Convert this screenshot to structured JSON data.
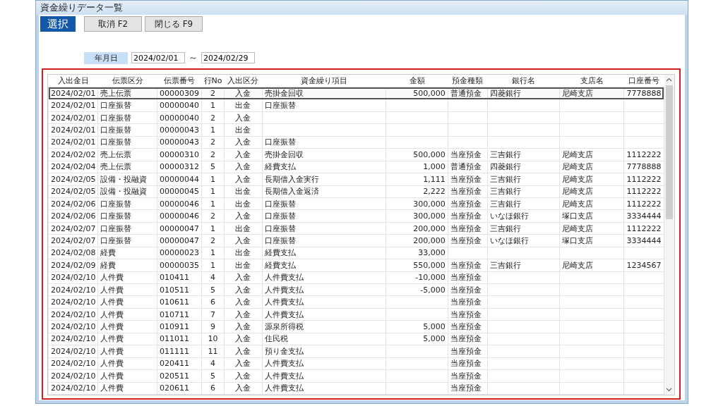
{
  "window": {
    "title": "資金繰りデータ一覧"
  },
  "toolbar": [
    {
      "label": "選択",
      "kind": "primary"
    },
    {
      "label": "取消 F2",
      "kind": "normal"
    },
    {
      "label": "閉じる F9",
      "kind": "normal"
    }
  ],
  "filter": {
    "label": "年月日",
    "from": "2024/02/01",
    "separator": "～",
    "to": "2024/02/29"
  },
  "table": {
    "columns": [
      "入出金日",
      "伝票区分",
      "伝票番号",
      "行No",
      "入出区分",
      "資金繰り項目",
      "金額",
      "預金種類",
      "銀行名",
      "支店名",
      "口座番号"
    ],
    "rows": [
      {
        "selected": true,
        "cells": [
          "2024/02/01",
          "売上伝票",
          "00000309",
          "2",
          "入金",
          "売掛金回収",
          "500,000",
          "普通預金",
          "四菱銀行",
          "尼崎支店",
          "7778888"
        ]
      },
      {
        "selected": false,
        "cells": [
          "2024/02/01",
          "口座振替",
          "00000040",
          "1",
          "出金",
          "口座振替"
        ]
      },
      {
        "selected": false,
        "cells": [
          "2024/02/01",
          "口座振替",
          "00000040",
          "2",
          "入金"
        ]
      },
      {
        "selected": false,
        "cells": [
          "2024/02/01",
          "口座振替",
          "00000043",
          "1",
          "出金"
        ]
      },
      {
        "selected": false,
        "cells": [
          "2024/02/01",
          "口座振替",
          "00000043",
          "2",
          "入金",
          "口座振替"
        ]
      },
      {
        "selected": false,
        "cells": [
          "2024/02/02",
          "売上伝票",
          "00000310",
          "2",
          "入金",
          "売掛金回収",
          "500,000",
          "当座預金",
          "三吉銀行",
          "尼崎支店",
          "1112222"
        ]
      },
      {
        "selected": false,
        "cells": [
          "2024/02/04",
          "売上伝票",
          "00000312",
          "5",
          "入金",
          "経費支払",
          "1,000",
          "普通預金",
          "四菱銀行",
          "尼崎支店",
          "7778888"
        ]
      },
      {
        "selected": false,
        "cells": [
          "2024/02/05",
          "設備・投融資",
          "00000044",
          "1",
          "入金",
          "長期借入金実行",
          "1,111",
          "当座預金",
          "三吉銀行",
          "尼崎支店",
          "1112222"
        ]
      },
      {
        "selected": false,
        "cells": [
          "2024/02/05",
          "設備・投融資",
          "00000045",
          "1",
          "出金",
          "長期借入金返済",
          "2,222",
          "当座預金",
          "三吉銀行",
          "尼崎支店",
          "1112222"
        ]
      },
      {
        "selected": false,
        "cells": [
          "2024/02/06",
          "口座振替",
          "00000046",
          "1",
          "出金",
          "口座振替",
          "300,000",
          "当座預金",
          "三吉銀行",
          "尼崎支店",
          "1112222"
        ]
      },
      {
        "selected": false,
        "cells": [
          "2024/02/06",
          "口座振替",
          "00000046",
          "2",
          "入金",
          "口座振替",
          "300,000",
          "当座預金",
          "いなほ銀行",
          "塚口支店",
          "3334444"
        ]
      },
      {
        "selected": false,
        "cells": [
          "2024/02/07",
          "口座振替",
          "00000047",
          "1",
          "出金",
          "口座振替",
          "200,000",
          "当座預金",
          "三吉銀行",
          "尼崎支店",
          "1112222"
        ]
      },
      {
        "selected": false,
        "cells": [
          "2024/02/07",
          "口座振替",
          "00000047",
          "2",
          "入金",
          "口座振替",
          "200,000",
          "当座預金",
          "いなほ銀行",
          "塚口支店",
          "3334444"
        ]
      },
      {
        "selected": false,
        "cells": [
          "2024/02/08",
          "経費",
          "00000023",
          "1",
          "出金",
          "経費支払",
          "33,000"
        ]
      },
      {
        "selected": false,
        "cells": [
          "2024/02/09",
          "経費",
          "00000035",
          "1",
          "出金",
          "経費支払",
          "550,000",
          "当座預金",
          "三吉銀行",
          "尼崎支店",
          "1234567"
        ]
      },
      {
        "selected": false,
        "cells": [
          "2024/02/10",
          "人件費",
          "010411",
          "4",
          "入金",
          "人件費支払",
          "-10,000",
          "当座預金"
        ]
      },
      {
        "selected": false,
        "cells": [
          "2024/02/10",
          "人件費",
          "010511",
          "5",
          "入金",
          "人件費支払",
          "-5,000",
          "当座預金"
        ]
      },
      {
        "selected": false,
        "cells": [
          "2024/02/10",
          "人件費",
          "010611",
          "6",
          "入金",
          "人件費支払",
          null,
          "当座預金"
        ]
      },
      {
        "selected": false,
        "cells": [
          "2024/02/10",
          "人件費",
          "010711",
          "7",
          "入金",
          "人件費支払",
          null,
          "当座預金"
        ]
      },
      {
        "selected": false,
        "cells": [
          "2024/02/10",
          "人件費",
          "010911",
          "9",
          "入金",
          "源泉所得税",
          "5,000",
          "当座預金"
        ]
      },
      {
        "selected": false,
        "cells": [
          "2024/02/10",
          "人件費",
          "011011",
          "10",
          "入金",
          "住民税",
          "5,000",
          "当座預金"
        ]
      },
      {
        "selected": false,
        "cells": [
          "2024/02/10",
          "人件費",
          "011111",
          "11",
          "入金",
          "預り金支払",
          null,
          "当座預金"
        ]
      },
      {
        "selected": false,
        "cells": [
          "2024/02/10",
          "人件費",
          "020411",
          "4",
          "入金",
          "人件費支払",
          null,
          "当座預金"
        ]
      },
      {
        "selected": false,
        "cells": [
          "2024/02/10",
          "人件費",
          "020511",
          "5",
          "入金",
          "人件費支払",
          null,
          "当座預金"
        ]
      },
      {
        "selected": false,
        "cells": [
          "2024/02/10",
          "人件費",
          "020611",
          "6",
          "入金",
          "人件費支払",
          null,
          "当座預金"
        ]
      }
    ]
  }
}
